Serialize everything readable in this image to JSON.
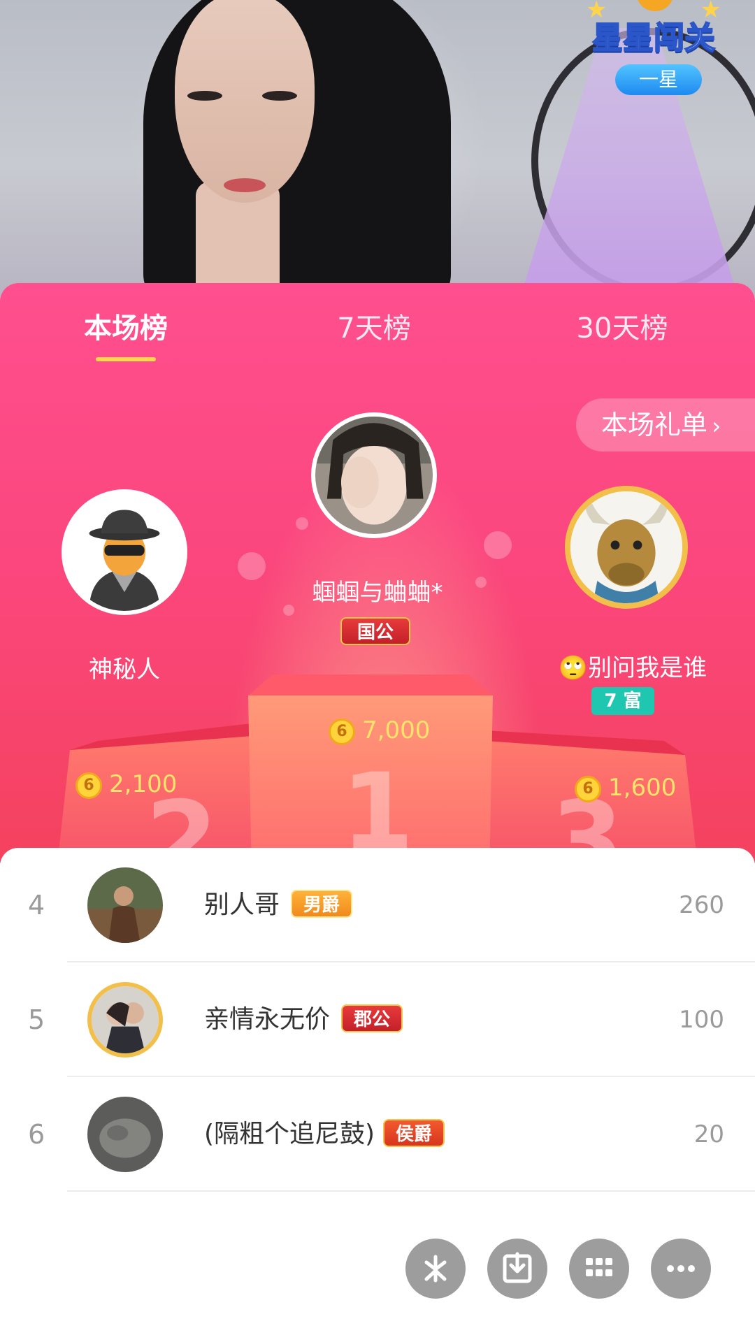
{
  "overlay": {
    "level_title": "星星闯关",
    "level_pill": "一星"
  },
  "tabs": [
    {
      "label": "本场榜",
      "active": true
    },
    {
      "label": "7天榜",
      "active": false
    },
    {
      "label": "30天榜",
      "active": false
    }
  ],
  "gift_list_button": {
    "label": "本场礼单",
    "icon": "chevron-right-icon"
  },
  "podium": {
    "first": {
      "rank": "1",
      "name": "蝈蝈与蛐蛐*",
      "badge": "国公",
      "amount": "7,000",
      "coin_label": "6"
    },
    "second": {
      "rank": "2",
      "name": "神秘人",
      "amount": "2,100",
      "coin_label": "6",
      "avatar_icon": "mystery-person-icon"
    },
    "third": {
      "rank": "3",
      "name": "别问我是谁",
      "emoji": "🙄",
      "badge": "7 富",
      "amount": "1,600",
      "coin_label": "6"
    }
  },
  "list": [
    {
      "rank": "4",
      "name": "别人哥",
      "badge": "男爵",
      "score": "260"
    },
    {
      "rank": "5",
      "name": "亲情永无价",
      "badge": "郡公",
      "score": "100"
    },
    {
      "rank": "6",
      "name": "(隔粗个追尼鼓)",
      "badge": "侯爵",
      "score": "20"
    }
  ],
  "actions": [
    {
      "name": "sparkle-icon"
    },
    {
      "name": "download-icon"
    },
    {
      "name": "grid-icon"
    },
    {
      "name": "more-icon"
    }
  ],
  "colors": {
    "accent_pink": "#ff4f8e",
    "tab_underline": "#ffd84a",
    "coin": "#ffd43a",
    "amount_text": "#ffe36b"
  }
}
